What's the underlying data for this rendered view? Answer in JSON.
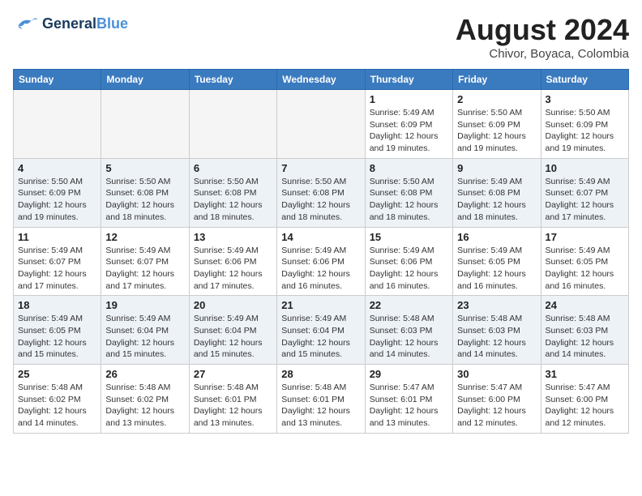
{
  "header": {
    "logo": "GeneralBlue",
    "month": "August 2024",
    "location": "Chivor, Boyaca, Colombia"
  },
  "weekdays": [
    "Sunday",
    "Monday",
    "Tuesday",
    "Wednesday",
    "Thursday",
    "Friday",
    "Saturday"
  ],
  "weeks": [
    [
      {
        "day": "",
        "info": ""
      },
      {
        "day": "",
        "info": ""
      },
      {
        "day": "",
        "info": ""
      },
      {
        "day": "",
        "info": ""
      },
      {
        "day": "1",
        "info": "Sunrise: 5:49 AM\nSunset: 6:09 PM\nDaylight: 12 hours\nand 19 minutes."
      },
      {
        "day": "2",
        "info": "Sunrise: 5:50 AM\nSunset: 6:09 PM\nDaylight: 12 hours\nand 19 minutes."
      },
      {
        "day": "3",
        "info": "Sunrise: 5:50 AM\nSunset: 6:09 PM\nDaylight: 12 hours\nand 19 minutes."
      }
    ],
    [
      {
        "day": "4",
        "info": "Sunrise: 5:50 AM\nSunset: 6:09 PM\nDaylight: 12 hours\nand 19 minutes."
      },
      {
        "day": "5",
        "info": "Sunrise: 5:50 AM\nSunset: 6:08 PM\nDaylight: 12 hours\nand 18 minutes."
      },
      {
        "day": "6",
        "info": "Sunrise: 5:50 AM\nSunset: 6:08 PM\nDaylight: 12 hours\nand 18 minutes."
      },
      {
        "day": "7",
        "info": "Sunrise: 5:50 AM\nSunset: 6:08 PM\nDaylight: 12 hours\nand 18 minutes."
      },
      {
        "day": "8",
        "info": "Sunrise: 5:50 AM\nSunset: 6:08 PM\nDaylight: 12 hours\nand 18 minutes."
      },
      {
        "day": "9",
        "info": "Sunrise: 5:49 AM\nSunset: 6:08 PM\nDaylight: 12 hours\nand 18 minutes."
      },
      {
        "day": "10",
        "info": "Sunrise: 5:49 AM\nSunset: 6:07 PM\nDaylight: 12 hours\nand 17 minutes."
      }
    ],
    [
      {
        "day": "11",
        "info": "Sunrise: 5:49 AM\nSunset: 6:07 PM\nDaylight: 12 hours\nand 17 minutes."
      },
      {
        "day": "12",
        "info": "Sunrise: 5:49 AM\nSunset: 6:07 PM\nDaylight: 12 hours\nand 17 minutes."
      },
      {
        "day": "13",
        "info": "Sunrise: 5:49 AM\nSunset: 6:06 PM\nDaylight: 12 hours\nand 17 minutes."
      },
      {
        "day": "14",
        "info": "Sunrise: 5:49 AM\nSunset: 6:06 PM\nDaylight: 12 hours\nand 16 minutes."
      },
      {
        "day": "15",
        "info": "Sunrise: 5:49 AM\nSunset: 6:06 PM\nDaylight: 12 hours\nand 16 minutes."
      },
      {
        "day": "16",
        "info": "Sunrise: 5:49 AM\nSunset: 6:05 PM\nDaylight: 12 hours\nand 16 minutes."
      },
      {
        "day": "17",
        "info": "Sunrise: 5:49 AM\nSunset: 6:05 PM\nDaylight: 12 hours\nand 16 minutes."
      }
    ],
    [
      {
        "day": "18",
        "info": "Sunrise: 5:49 AM\nSunset: 6:05 PM\nDaylight: 12 hours\nand 15 minutes."
      },
      {
        "day": "19",
        "info": "Sunrise: 5:49 AM\nSunset: 6:04 PM\nDaylight: 12 hours\nand 15 minutes."
      },
      {
        "day": "20",
        "info": "Sunrise: 5:49 AM\nSunset: 6:04 PM\nDaylight: 12 hours\nand 15 minutes."
      },
      {
        "day": "21",
        "info": "Sunrise: 5:49 AM\nSunset: 6:04 PM\nDaylight: 12 hours\nand 15 minutes."
      },
      {
        "day": "22",
        "info": "Sunrise: 5:48 AM\nSunset: 6:03 PM\nDaylight: 12 hours\nand 14 minutes."
      },
      {
        "day": "23",
        "info": "Sunrise: 5:48 AM\nSunset: 6:03 PM\nDaylight: 12 hours\nand 14 minutes."
      },
      {
        "day": "24",
        "info": "Sunrise: 5:48 AM\nSunset: 6:03 PM\nDaylight: 12 hours\nand 14 minutes."
      }
    ],
    [
      {
        "day": "25",
        "info": "Sunrise: 5:48 AM\nSunset: 6:02 PM\nDaylight: 12 hours\nand 14 minutes."
      },
      {
        "day": "26",
        "info": "Sunrise: 5:48 AM\nSunset: 6:02 PM\nDaylight: 12 hours\nand 13 minutes."
      },
      {
        "day": "27",
        "info": "Sunrise: 5:48 AM\nSunset: 6:01 PM\nDaylight: 12 hours\nand 13 minutes."
      },
      {
        "day": "28",
        "info": "Sunrise: 5:48 AM\nSunset: 6:01 PM\nDaylight: 12 hours\nand 13 minutes."
      },
      {
        "day": "29",
        "info": "Sunrise: 5:47 AM\nSunset: 6:01 PM\nDaylight: 12 hours\nand 13 minutes."
      },
      {
        "day": "30",
        "info": "Sunrise: 5:47 AM\nSunset: 6:00 PM\nDaylight: 12 hours\nand 12 minutes."
      },
      {
        "day": "31",
        "info": "Sunrise: 5:47 AM\nSunset: 6:00 PM\nDaylight: 12 hours\nand 12 minutes."
      }
    ]
  ]
}
